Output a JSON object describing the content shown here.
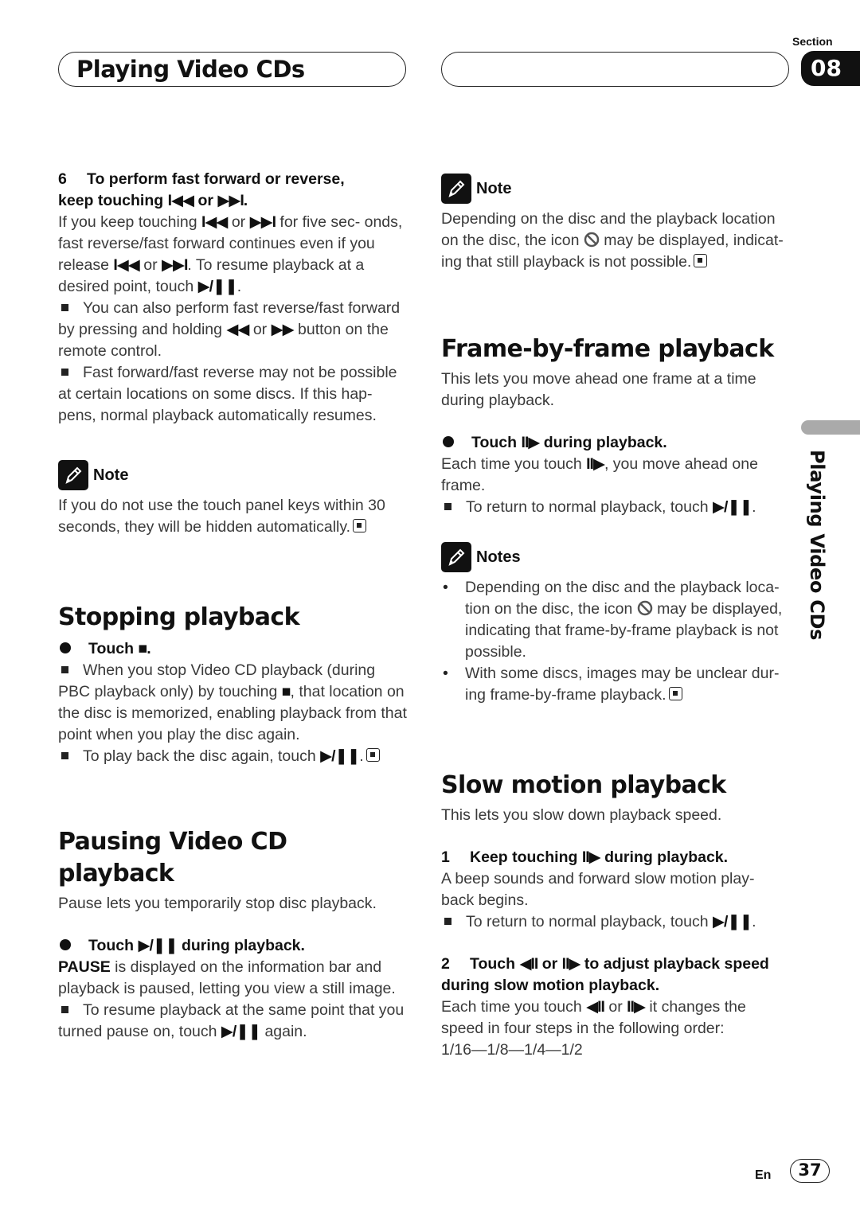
{
  "header": {
    "title": "Playing Video CDs",
    "section_label": "Section",
    "section_number": "08"
  },
  "side_tab": {
    "label": "Playing Video CDs"
  },
  "footer": {
    "language": "En",
    "page_number": "37"
  },
  "symbols": {
    "prev": "⏮",
    "prev_glyph": "I◀◀",
    "next_glyph": "▶▶I",
    "play_pause": "▶/❚❚",
    "stop": "■",
    "rew": "◀◀",
    "ff": "▶▶",
    "step_fwd": "II▶",
    "step_back": "◀II"
  },
  "left": {
    "step6": {
      "number": "6",
      "title_a": "To perform fast forward or reverse,",
      "title_b": "keep touching",
      "title_or": "or",
      "title_end": ".",
      "body_1": "If you keep touching",
      "body_2": "or",
      "body_3": "for five sec- onds, fast reverse/fast forward continues even if you release",
      "body_4": "or",
      "body_5": ". To resume playback at a desired point, touch",
      "body_6": ".",
      "bullets": [
        {
          "a": "You can also perform fast reverse/fast forward by pressing and holding",
          "b": "or",
          "c": "button on the remote control."
        },
        {
          "a": "Fast forward/fast reverse may not be possible at certain locations on some discs. If this hap- pens, normal playback automatically resumes."
        }
      ]
    },
    "note1": {
      "title": "Note",
      "text": "If you do not use the touch panel keys within 30 seconds, they will be hidden automatically."
    },
    "stopping": {
      "heading": "Stopping playback",
      "action_a": "Touch",
      "action_b": ".",
      "bullet1_a": "When you stop Video CD playback (during PBC playback only) by touching",
      "bullet1_b": ", that location on the disc is memorized, enabling playback from that point when you play the disc again.",
      "bullet2_a": "To play back the disc again, touch",
      "bullet2_b": "."
    },
    "pausing": {
      "heading": "Pausing Video CD playback",
      "intro": "Pause lets you temporarily stop disc playback.",
      "action_a": "Touch",
      "action_b": "during playback.",
      "pause_word": "PAUSE",
      "body": " is displayed on the information bar and playback is paused, letting you view a still image.",
      "bullet_a": "To resume playback at the same point that you turned pause on, touch",
      "bullet_b": "again."
    }
  },
  "right": {
    "note1": {
      "title": "Note",
      "text_a": "Depending on the disc and the playback location on the disc, the icon",
      "text_b": "may be displayed, indicat- ing that still playback is not possible."
    },
    "frame": {
      "heading": "Frame-by-frame playback",
      "intro": "This lets you move ahead one frame at a time during playback.",
      "action_a": "Touch",
      "action_b": "during playback.",
      "body_a": "Each time you touch",
      "body_b": ", you move ahead one frame.",
      "bullet_a": "To return to normal playback, touch",
      "bullet_b": "."
    },
    "notes2": {
      "title": "Notes",
      "items": [
        {
          "a": "Depending on the disc and the playback loca- tion on the disc, the icon",
          "b": "may be displayed, indicating that frame-by-frame playback is not possible."
        },
        {
          "a": "With some discs, images may be unclear dur- ing frame-by-frame playback."
        }
      ]
    },
    "slow": {
      "heading": "Slow motion playback",
      "intro": "This lets you slow down playback speed.",
      "step1_num": "1",
      "step1_a": "Keep touching",
      "step1_b": "during playback.",
      "step1_body": "A beep sounds and forward slow motion play- back begins.",
      "step1_bullet_a": "To return to normal playback, touch",
      "step1_bullet_b": ".",
      "step2_num": "2",
      "step2_a": "Touch",
      "step2_or": "or",
      "step2_b": "to adjust playback speed during slow motion playback.",
      "step2_body_a": "Each time you touch",
      "step2_body_or": "or",
      "step2_body_b": "it changes the speed in four steps in the following order:",
      "speed_order": "1/16—1/8—1/4—1/2"
    }
  }
}
